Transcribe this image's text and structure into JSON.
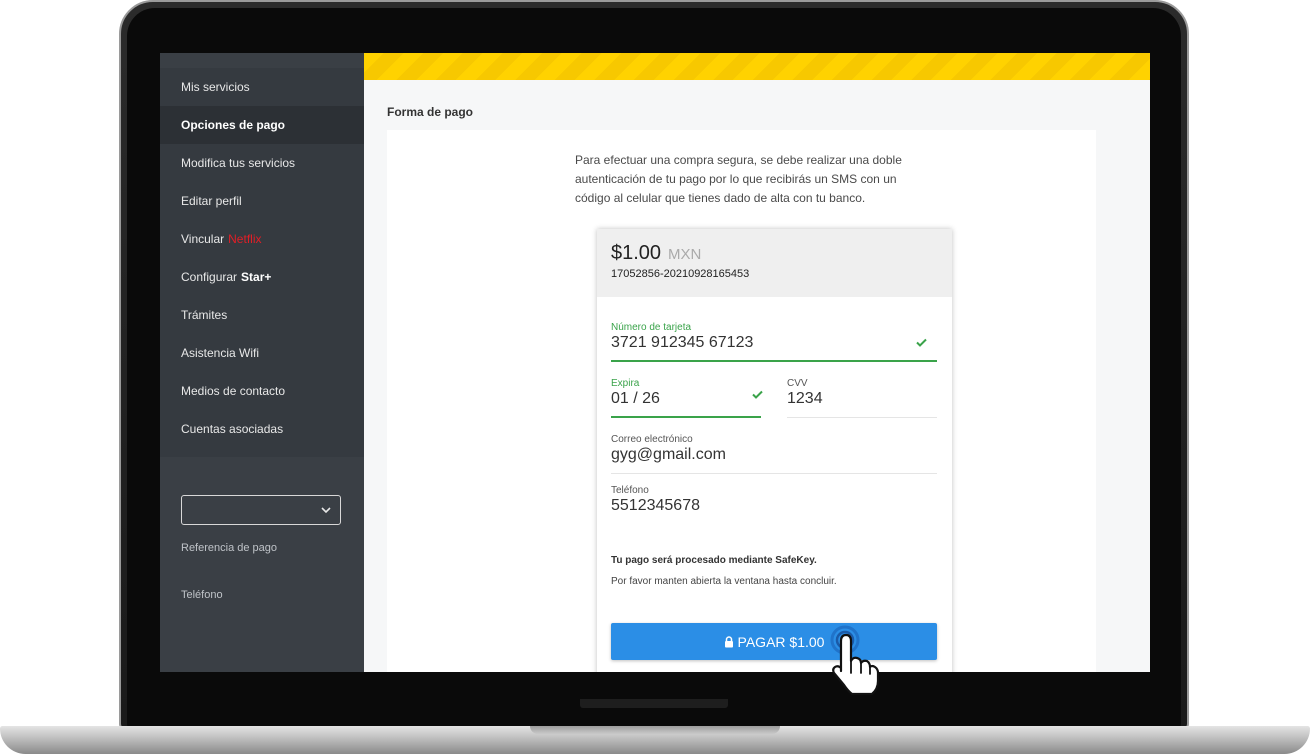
{
  "sidebar": {
    "items": [
      {
        "label": "Mis servicios"
      },
      {
        "label": "Opciones de pago",
        "active": true
      },
      {
        "label": "Modifica tus servicios"
      },
      {
        "label": "Editar perfil"
      },
      {
        "label": "Vincular",
        "accent": "Netflix"
      },
      {
        "label": "Configurar",
        "accent": "Star+"
      },
      {
        "label": "Trámites"
      },
      {
        "label": "Asistencia Wifi"
      },
      {
        "label": "Medios de contacto"
      },
      {
        "label": "Cuentas asociadas"
      }
    ],
    "select": {
      "value": ""
    },
    "referencia_label": "Referencia de pago",
    "telefono_label": "Teléfono"
  },
  "main": {
    "section_title": "Forma de pago",
    "intro": "Para efectuar una compra segura, se debe realizar una doble autenticación de tu pago por lo que recibirás un SMS con un código al celular que tienes dado de alta con tu banco."
  },
  "payment": {
    "amount": "$1.00",
    "currency": "MXN",
    "order_id": "17052856-20210928165453",
    "card_number": {
      "label": "Número de tarjeta",
      "value": "3721 912345 67123",
      "valid": true
    },
    "expiry": {
      "label": "Expira",
      "value": "01 / 26",
      "valid": true
    },
    "cvv": {
      "label": "CVV",
      "value": "1234"
    },
    "email": {
      "label": "Correo electrónico",
      "value": "gyg@gmail.com"
    },
    "phone": {
      "label": "Teléfono",
      "value": "5512345678"
    },
    "note_bold": "Tu pago será procesado mediante SafeKey.",
    "note": "Por favor manten abierta la ventana hasta concluir.",
    "pay_button": "PAGAR $1.00"
  },
  "icons": {
    "lock": "lock-icon",
    "check": "check-icon",
    "chevron": "chevron-down-icon",
    "cursor": "hand-pointer-icon"
  },
  "colors": {
    "sidebar": "#3a3f45",
    "banner": "#ffd200",
    "valid": "#3aa34a",
    "button": "#2b8ee6",
    "netflix": "#e21e26"
  }
}
